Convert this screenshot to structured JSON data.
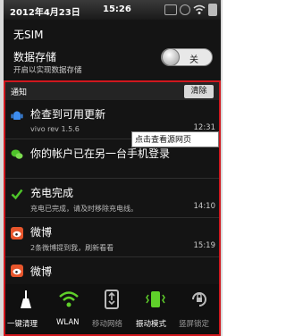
{
  "status_bar": {
    "date": "2012年4月23日",
    "time": "15:26"
  },
  "sim_status": "无SIM",
  "storage": {
    "title": "数据存储",
    "subtitle": "开启以实现数据存储",
    "toggle_label": "关"
  },
  "notifications": {
    "header": "通知",
    "clear_label": "清除",
    "items": [
      {
        "title": "检查到可用更新",
        "subtitle": "vivo rev 1.5.6",
        "time": "12:31"
      },
      {
        "title": "你的帐户已在另一台手机登录",
        "subtitle": "",
        "time": ""
      },
      {
        "title": "充电完成",
        "subtitle": "充电已完成，请及时移除充电线。",
        "time": "14:10"
      },
      {
        "title": "微博",
        "subtitle": "2条微博提到我，刷新看看",
        "time": "15:19"
      },
      {
        "title": "微博",
        "subtitle": "",
        "time": ""
      }
    ]
  },
  "tooltip": "点击查看源网页",
  "quick_settings": [
    {
      "label": "一键清理",
      "active": true
    },
    {
      "label": "WLAN",
      "active": true
    },
    {
      "label": "移动网络",
      "active": false
    },
    {
      "label": "振动模式",
      "active": true
    },
    {
      "label": "竖屏锁定",
      "active": false
    }
  ],
  "colors": {
    "highlight_border": "#d0181e",
    "active_green": "#5fd02a"
  }
}
